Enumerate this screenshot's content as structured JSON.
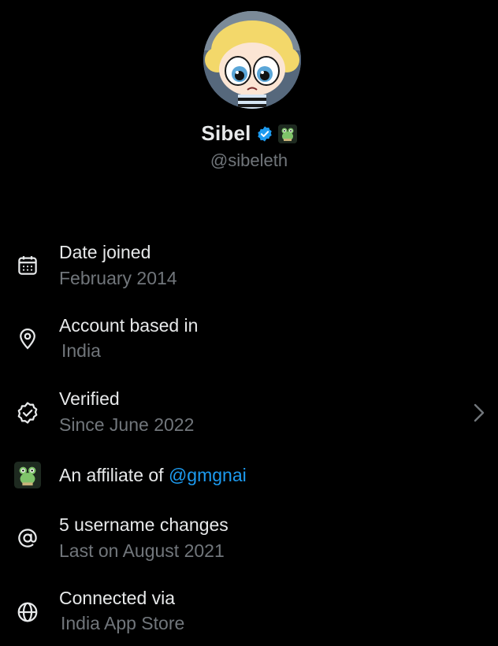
{
  "profile": {
    "display_name": "Sibel",
    "handle": "@sibeleth",
    "verified_badge_icon": "verified-check-icon",
    "affiliate_badge_icon": "frog-badge-icon",
    "accent_color": "#1d9bf0"
  },
  "details": {
    "date_joined": {
      "title": "Date joined",
      "value": "February 2014",
      "icon": "calendar-icon"
    },
    "account_based": {
      "title": "Account based in",
      "value": "India",
      "icon": "location-pin-icon"
    },
    "verified": {
      "title": "Verified",
      "value": "Since June 2022",
      "icon": "verified-seal-icon"
    },
    "affiliate": {
      "prefix": "An affiliate of ",
      "link": "@gmgnai",
      "icon": "frog-badge-icon"
    },
    "username_changes": {
      "title": "5 username changes",
      "value": "Last on August 2021",
      "icon": "at-sign-icon"
    },
    "connected_via": {
      "title": "Connected via",
      "value": "India App Store",
      "icon": "globe-icon"
    }
  }
}
